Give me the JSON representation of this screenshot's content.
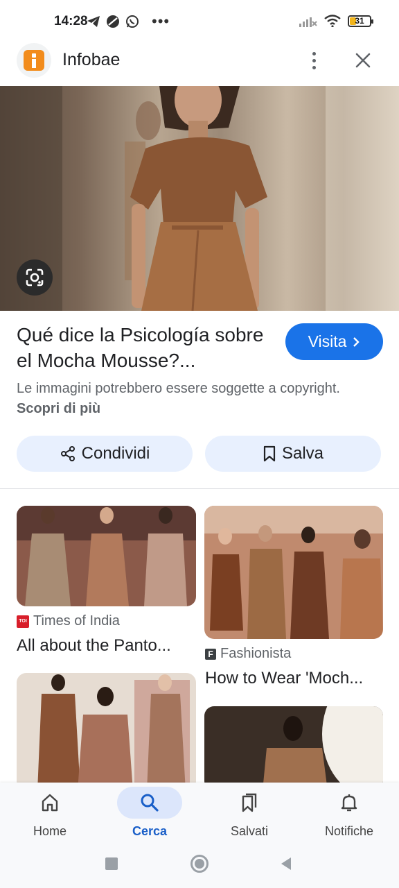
{
  "status_bar": {
    "time": "14:28",
    "more": "•••",
    "battery": "31",
    "battery_level": 0.31
  },
  "header": {
    "site_name": "Infobae",
    "menu_icon": "more-vert-icon",
    "close_icon": "close-icon"
  },
  "result": {
    "title": "Qué dice la Psicología sobre el Mocha Mousse?...",
    "visit_label": "Visita",
    "copyright_text": "Le immagini potrebbero essere soggette a copyright.",
    "learn_more": "Scopri di più"
  },
  "actions": {
    "share_label": "Condividi",
    "save_label": "Salva"
  },
  "cards": [
    {
      "source": "Times of India",
      "title": "All about the Panto..."
    },
    {
      "source": "Fashionista",
      "title": "How to Wear 'Moch..."
    }
  ],
  "bottom_nav": [
    {
      "label": "Home",
      "icon": "home-icon",
      "active": false
    },
    {
      "label": "Cerca",
      "icon": "search-icon",
      "active": true
    },
    {
      "label": "Salvati",
      "icon": "bookmarks-icon",
      "active": false
    },
    {
      "label": "Notifiche",
      "icon": "bell-icon",
      "active": false
    }
  ],
  "colors": {
    "accent": "#1a73e8",
    "chip_bg": "#e8f0fe",
    "nav_active_bg": "#dce6fb",
    "logo_orange": "#f28c1c"
  }
}
